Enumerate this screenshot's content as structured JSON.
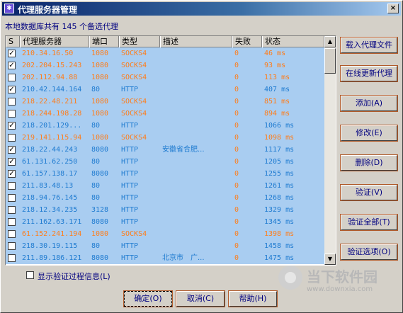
{
  "window": {
    "title": "代理服务器管理",
    "close_label": "×"
  },
  "summary": "本地数据库共有 145 个备选代理",
  "table": {
    "headers": [
      "S",
      "代理服务器",
      "端口",
      "类型",
      "描述",
      "失败",
      "状态"
    ],
    "rows": [
      {
        "checked": true,
        "server": "210.34.16.50",
        "port": "1080",
        "type": "SOCKS4",
        "desc": "",
        "fail": "0",
        "status": "46 ms",
        "state": "bad"
      },
      {
        "checked": true,
        "server": "202.204.15.243",
        "port": "1080",
        "type": "SOCKS4",
        "desc": "",
        "fail": "0",
        "status": "93 ms",
        "state": "bad"
      },
      {
        "checked": false,
        "server": "202.112.94.88",
        "port": "1080",
        "type": "SOCKS4",
        "desc": "",
        "fail": "0",
        "status": "113 ms",
        "state": "bad"
      },
      {
        "checked": true,
        "server": "210.42.144.164",
        "port": "80",
        "type": "HTTP",
        "desc": "",
        "fail": "0",
        "status": "407 ms",
        "state": "ok"
      },
      {
        "checked": false,
        "server": "218.22.48.211",
        "port": "1080",
        "type": "SOCKS4",
        "desc": "",
        "fail": "0",
        "status": "851 ms",
        "state": "bad"
      },
      {
        "checked": false,
        "server": "218.244.198.28",
        "port": "1080",
        "type": "SOCKS4",
        "desc": "",
        "fail": "0",
        "status": "894 ms",
        "state": "bad"
      },
      {
        "checked": true,
        "server": "218.201.129...",
        "port": "80",
        "type": "HTTP",
        "desc": "",
        "fail": "0",
        "status": "1066 ms",
        "state": "ok"
      },
      {
        "checked": false,
        "server": "219.141.115.94",
        "port": "1080",
        "type": "SOCKS4",
        "desc": "",
        "fail": "0",
        "status": "1098 ms",
        "state": "bad"
      },
      {
        "checked": true,
        "server": "218.22.44.243",
        "port": "8080",
        "type": "HTTP",
        "desc": "安徽省合肥...",
        "fail": "0",
        "status": "1117 ms",
        "state": "ok"
      },
      {
        "checked": true,
        "server": "61.131.62.250",
        "port": "80",
        "type": "HTTP",
        "desc": "",
        "fail": "0",
        "status": "1205 ms",
        "state": "ok"
      },
      {
        "checked": true,
        "server": "61.157.138.17",
        "port": "8080",
        "type": "HTTP",
        "desc": "",
        "fail": "0",
        "status": "1255 ms",
        "state": "ok"
      },
      {
        "checked": false,
        "server": "211.83.48.13",
        "port": "80",
        "type": "HTTP",
        "desc": "",
        "fail": "0",
        "status": "1261 ms",
        "state": "ok"
      },
      {
        "checked": false,
        "server": "218.94.76.145",
        "port": "80",
        "type": "HTTP",
        "desc": "",
        "fail": "0",
        "status": "1268 ms",
        "state": "ok"
      },
      {
        "checked": false,
        "server": "218.12.34.235",
        "port": "3128",
        "type": "HTTP",
        "desc": "",
        "fail": "0",
        "status": "1329 ms",
        "state": "ok"
      },
      {
        "checked": false,
        "server": "211.162.63.171",
        "port": "8080",
        "type": "HTTP",
        "desc": "",
        "fail": "0",
        "status": "1345 ms",
        "state": "ok"
      },
      {
        "checked": false,
        "server": "61.152.241.194",
        "port": "1080",
        "type": "SOCKS4",
        "desc": "",
        "fail": "0",
        "status": "1398 ms",
        "state": "bad"
      },
      {
        "checked": false,
        "server": "218.30.19.115",
        "port": "80",
        "type": "HTTP",
        "desc": "",
        "fail": "0",
        "status": "1458 ms",
        "state": "ok"
      },
      {
        "checked": false,
        "server": "211.89.186.121",
        "port": "8080",
        "type": "HTTP",
        "desc": "北京市　广...",
        "fail": "0",
        "status": "1475 ms",
        "state": "ok"
      }
    ]
  },
  "side_buttons": [
    {
      "label": "载入代理文件"
    },
    {
      "label": "在线更新代理"
    },
    {
      "label": "添加(A)"
    },
    {
      "label": "修改(E)"
    },
    {
      "label": "删除(D)"
    },
    {
      "label": "验证(V)"
    },
    {
      "label": "验证全部(T)"
    },
    {
      "label": "验证选项(O)"
    }
  ],
  "option": {
    "label": "显示验证过程信息(L)",
    "checked": false
  },
  "bottom_buttons": [
    {
      "label": "确定(O)"
    },
    {
      "label": "取消(C)"
    },
    {
      "label": "帮助(H)"
    }
  ],
  "watermark": {
    "name": "当下软件园",
    "url": "www.downxia.com"
  },
  "colors": {
    "row_bg": "#a9cdf1",
    "ok_text": "#1f7bd0",
    "bad_text": "#ff7d1a",
    "title_bar": "#0a246a"
  }
}
